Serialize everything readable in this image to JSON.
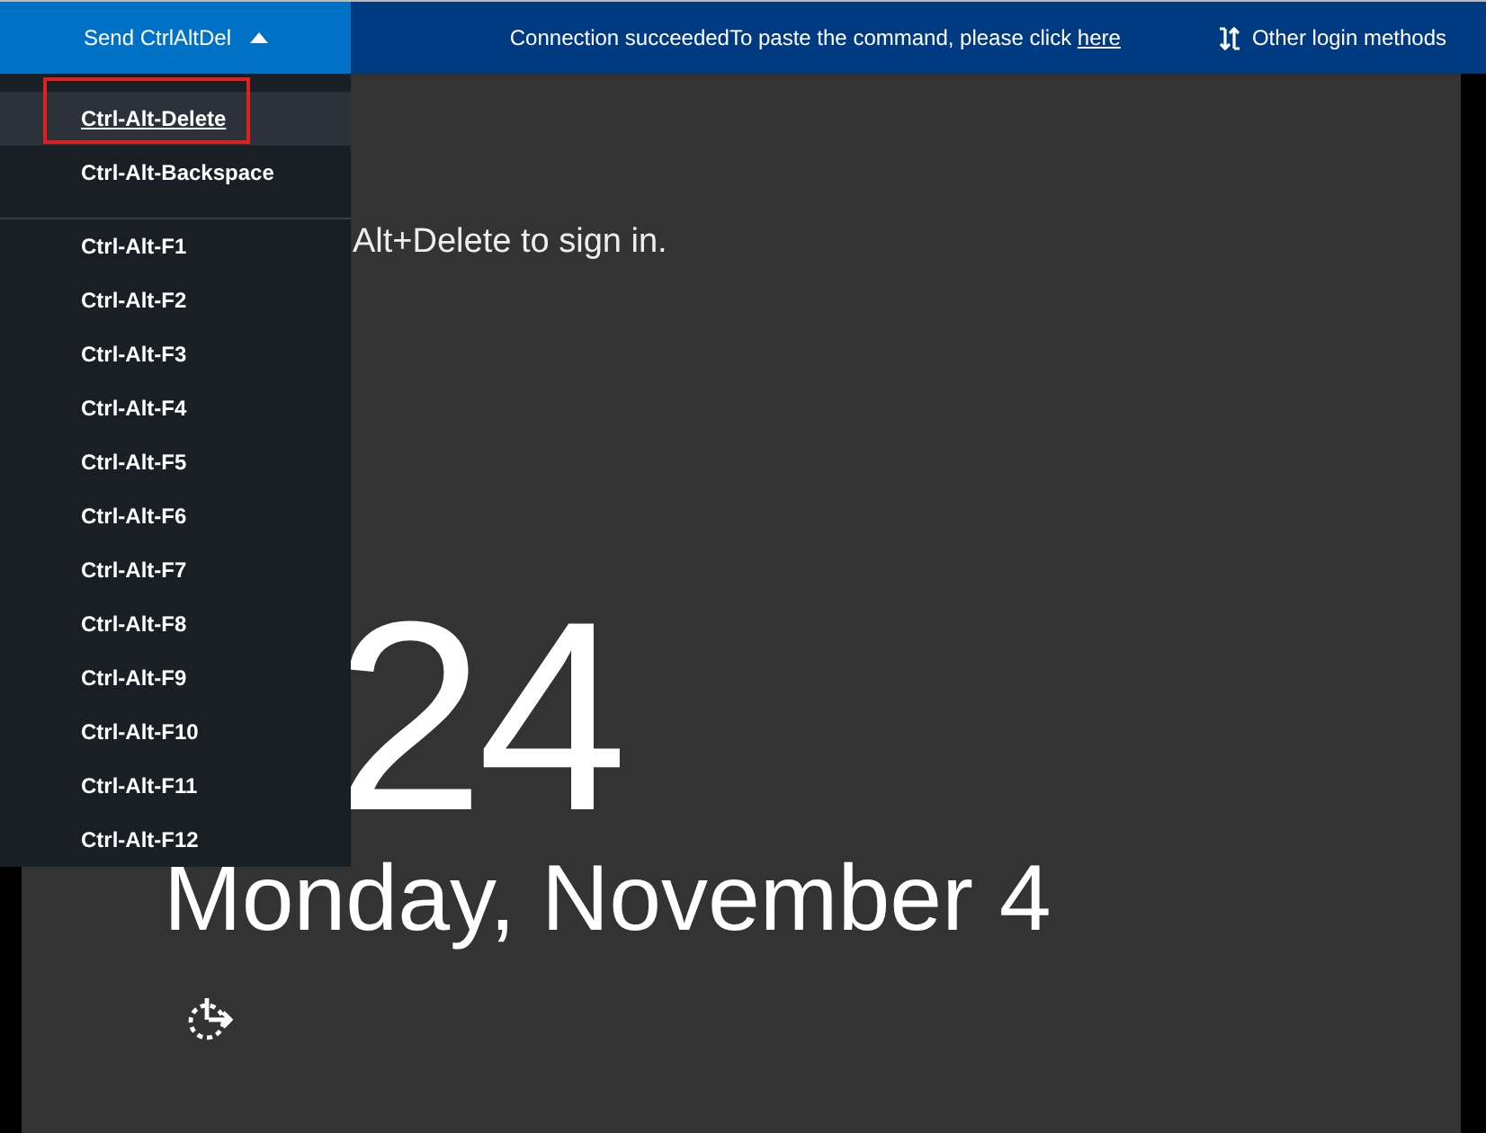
{
  "toolbar": {
    "send_button": {
      "label": "Send CtrlAltDel",
      "expanded": true
    },
    "status": {
      "message": "Connection succeededTo paste the command, please click ",
      "link": "here"
    },
    "other_login": {
      "label": "Other login methods"
    }
  },
  "menu": {
    "groups": [
      [
        {
          "label": "Ctrl-Alt-Delete",
          "selected": true
        },
        {
          "label": "Ctrl-Alt-Backspace",
          "selected": false
        }
      ],
      [
        {
          "label": "Ctrl-Alt-F1",
          "selected": false
        },
        {
          "label": "Ctrl-Alt-F2",
          "selected": false
        },
        {
          "label": "Ctrl-Alt-F3",
          "selected": false
        },
        {
          "label": "Ctrl-Alt-F4",
          "selected": false
        },
        {
          "label": "Ctrl-Alt-F5",
          "selected": false
        },
        {
          "label": "Ctrl-Alt-F6",
          "selected": false
        },
        {
          "label": "Ctrl-Alt-F7",
          "selected": false
        },
        {
          "label": "Ctrl-Alt-F8",
          "selected": false
        },
        {
          "label": "Ctrl-Alt-F9",
          "selected": false
        },
        {
          "label": "Ctrl-Alt-F10",
          "selected": false
        },
        {
          "label": "Ctrl-Alt-F11",
          "selected": false
        },
        {
          "label": "Ctrl-Alt-F12",
          "selected": false
        }
      ]
    ]
  },
  "lock_screen": {
    "prompt": "Alt+Delete to sign in.",
    "time": "24",
    "date": "Monday, November 4"
  }
}
